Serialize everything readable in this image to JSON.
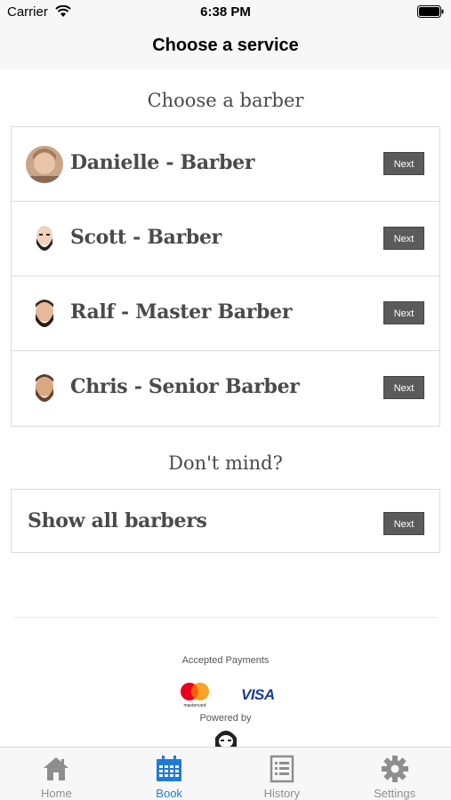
{
  "status_bar": {
    "carrier": "Carrier",
    "time": "6:38 PM"
  },
  "nav": {
    "title": "Choose a service"
  },
  "barber_section": {
    "heading": "Choose a barber",
    "barbers": [
      {
        "name": "Danielle - Barber",
        "button": "Next",
        "avatar": "photo-avatar"
      },
      {
        "name": "Scott - Barber",
        "button": "Next",
        "avatar": "bald-beard-avatar"
      },
      {
        "name": "Ralf - Master Barber",
        "button": "Next",
        "avatar": "beard-avatar"
      },
      {
        "name": "Chris - Senior Barber",
        "button": "Next",
        "avatar": "beard-avatar"
      }
    ]
  },
  "dont_mind": {
    "heading": "Don't mind?",
    "show_all_label": "Show all barbers",
    "button": "Next"
  },
  "footer": {
    "accepted_payments": "Accepted Payments",
    "mastercard_text": "mastercard",
    "visa_text": "VISA",
    "powered_by": "Powered by"
  },
  "tabs": [
    {
      "label": "Home",
      "icon": "home-icon",
      "active": false
    },
    {
      "label": "Book",
      "icon": "calendar-icon",
      "active": true
    },
    {
      "label": "History",
      "icon": "history-icon",
      "active": false
    },
    {
      "label": "Settings",
      "icon": "gear-icon",
      "active": false
    }
  ],
  "colors": {
    "accent": "#1f7ad8",
    "button": "#5b5b5b",
    "text": "#4a4a4a"
  }
}
